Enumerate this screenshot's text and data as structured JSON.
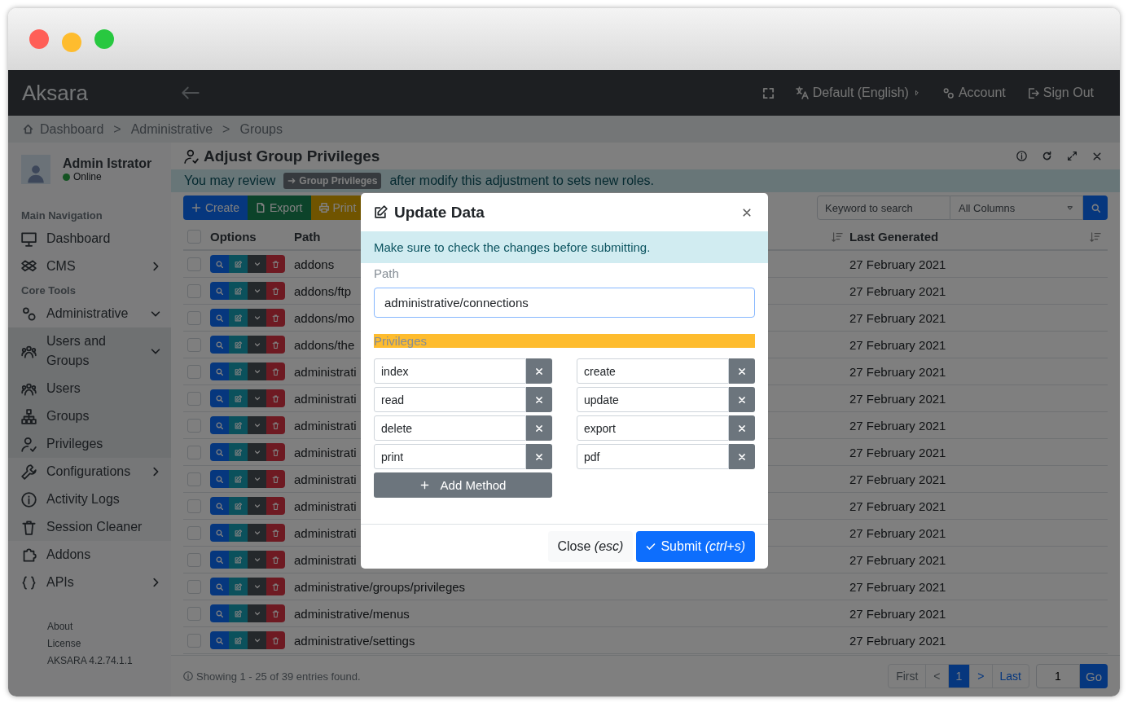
{
  "header": {
    "logo": "Aksara",
    "language": "Default (English)",
    "account": "Account",
    "sign_out": "Sign Out"
  },
  "breadcrumb": {
    "items": [
      "Dashboard",
      "Administrative",
      "Groups"
    ],
    "separator": ">"
  },
  "sidebar": {
    "user": {
      "name": "Admin Istrator",
      "status": "Online",
      "online": true
    },
    "sections": [
      {
        "heading": "Main Navigation",
        "items": [
          {
            "label": "Dashboard"
          },
          {
            "label": "CMS",
            "expanded": false
          }
        ]
      },
      {
        "heading": "Core Tools",
        "items": [
          {
            "label": "Administrative",
            "expanded": true,
            "children": [
              {
                "label": "Users and Groups",
                "expanded": true,
                "children": [
                  {
                    "label": "Users"
                  },
                  {
                    "label": "Groups"
                  },
                  {
                    "label": "Privileges"
                  }
                ]
              },
              {
                "label": "Configurations",
                "expanded": false
              },
              {
                "label": "Activity Logs"
              },
              {
                "label": "Session Cleaner"
              }
            ]
          },
          {
            "label": "Addons"
          },
          {
            "label": "APIs",
            "expanded": false
          }
        ]
      }
    ],
    "footer_links": [
      "About",
      "License"
    ],
    "version": "AKSARA 4.2.74.1.1"
  },
  "page": {
    "title": "Adjust Group Privileges",
    "notice_before": "You may review",
    "notice_badge": "Group Privileges",
    "notice_after": "after modify this adjustment to sets new roles."
  },
  "toolbar": {
    "buttons": [
      {
        "label": "Create",
        "kind": "create"
      },
      {
        "label": "Export",
        "kind": "export"
      },
      {
        "label": "Print",
        "kind": "print"
      }
    ],
    "search_placeholder": "Keyword to search",
    "column_select": "All Columns"
  },
  "table": {
    "select_all_checked": false,
    "columns": [
      "Options",
      "Path",
      "Last Generated"
    ],
    "rows": [
      {
        "path": "addons",
        "last_generated": "27 February 2021",
        "checked": false
      },
      {
        "path": "addons/ftp",
        "last_generated": "27 February 2021",
        "checked": false
      },
      {
        "path": "addons/mo",
        "last_generated": "27 February 2021",
        "checked": false
      },
      {
        "path": "addons/the",
        "last_generated": "27 February 2021",
        "checked": false
      },
      {
        "path": "administrati",
        "last_generated": "27 February 2021",
        "checked": false
      },
      {
        "path": "administrati",
        "last_generated": "27 February 2021",
        "checked": false
      },
      {
        "path": "administrati",
        "last_generated": "27 February 2021",
        "checked": false
      },
      {
        "path": "administrati",
        "last_generated": "27 February 2021",
        "checked": false
      },
      {
        "path": "administrati",
        "last_generated": "27 February 2021",
        "checked": false
      },
      {
        "path": "administrati",
        "last_generated": "27 February 2021",
        "checked": false
      },
      {
        "path": "administrati",
        "last_generated": "27 February 2021",
        "checked": false
      },
      {
        "path": "administrati",
        "last_generated": "27 February 2021",
        "checked": false
      },
      {
        "path": "administrative/groups/privileges",
        "last_generated": "27 February 2021",
        "checked": false
      },
      {
        "path": "administrative/menus",
        "last_generated": "27 February 2021",
        "checked": false
      },
      {
        "path": "administrative/settings",
        "last_generated": "27 February 2021",
        "checked": false
      }
    ]
  },
  "footer": {
    "summary": "Showing 1 - 25 of 39 entries found.",
    "pages": [
      {
        "label": "First",
        "disabled": true,
        "selected": false
      },
      {
        "label": "<",
        "disabled": true,
        "selected": false
      },
      {
        "label": "1",
        "disabled": false,
        "selected": true
      },
      {
        "label": ">",
        "disabled": false,
        "selected": false
      },
      {
        "label": "Last",
        "disabled": false,
        "selected": false
      }
    ],
    "page_input": "1",
    "go": "Go"
  },
  "modal": {
    "title": "Update Data",
    "alert": "Make sure to check the changes before submitting.",
    "path_label": "Path",
    "path_value": "administrative/connections",
    "privileges_label": "Privileges",
    "privileges": [
      "index",
      "create",
      "read",
      "update",
      "delete",
      "export",
      "print",
      "pdf"
    ],
    "add_button": "Add Method",
    "close_button": "Close *(esc)*",
    "submit_button": "Submit *(ctrl+s)*"
  }
}
